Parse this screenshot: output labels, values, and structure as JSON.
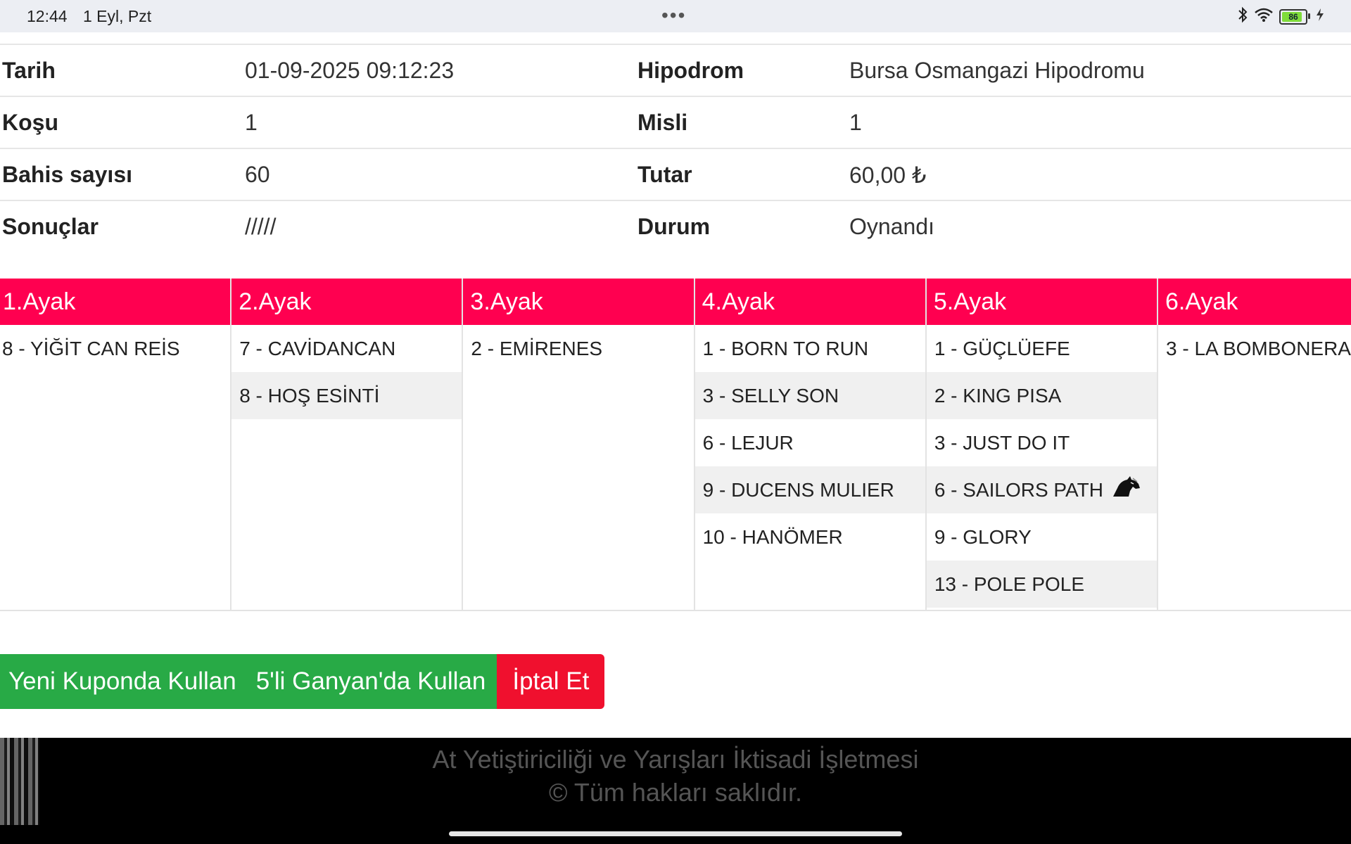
{
  "status_bar": {
    "time": "12:44",
    "date": "1 Eyl, Pzt",
    "dots": "•••",
    "battery_level": "86",
    "battery_fraction": 0.86,
    "icons": [
      "bluetooth-icon",
      "wifi-icon",
      "battery-icon",
      "charging-icon"
    ]
  },
  "info": [
    {
      "l1": "Tarih",
      "v1": "01-09-2025 09:12:23",
      "l2": "Hipodrom",
      "v2": "Bursa Osmangazi Hipodromu"
    },
    {
      "l1": "Koşu",
      "v1": "1",
      "l2": "Misli",
      "v2": "1"
    },
    {
      "l1": "Bahis sayısı",
      "v1": "60",
      "l2": "Tutar",
      "v2": "60,00 ₺"
    },
    {
      "l1": "Sonuçlar",
      "v1": "/////",
      "l2": "Durum",
      "v2": "Oynandı"
    }
  ],
  "legs": [
    {
      "title": "1.Ayak",
      "horses": [
        "8 - YİĞİT CAN REİS"
      ]
    },
    {
      "title": "2.Ayak",
      "horses": [
        "7 - CAVİDANCAN",
        "8 - HOŞ ESİNTİ"
      ]
    },
    {
      "title": "3.Ayak",
      "horses": [
        "2 - EMİRENES"
      ]
    },
    {
      "title": "4.Ayak",
      "horses": [
        "1 - BORN TO RUN",
        "3 - SELLY SON",
        "6 - LEJUR",
        "9 - DUCENS MULIER",
        "10 - HANÖMER"
      ]
    },
    {
      "title": "5.Ayak",
      "horses": [
        "1 - GÜÇLÜEFE",
        "2 - KING PISA",
        "3 - JUST DO IT",
        "6 - SAILORS PATH",
        "9 - GLORY",
        "13 - POLE POLE"
      ]
    },
    {
      "title": "6.Ayak",
      "horses": [
        "3 - LA BOMBONERA"
      ]
    }
  ],
  "horse_icon_on": "6 - SAILORS PATH",
  "actions": {
    "new_coupon": "Yeni Kuponda Kullan",
    "ganyan": "5'li Ganyan'da Kullan",
    "cancel": "İptal Et"
  },
  "footer": {
    "line1": "At Yetiştiriciliği ve Yarışları İktisadi İşletmesi",
    "line2": "© Tüm hakları saklıdır."
  },
  "colors": {
    "leg_header": "#ff0050",
    "button_green": "#28aa46",
    "button_red": "#f0102e",
    "footer_bg": "#000000"
  }
}
